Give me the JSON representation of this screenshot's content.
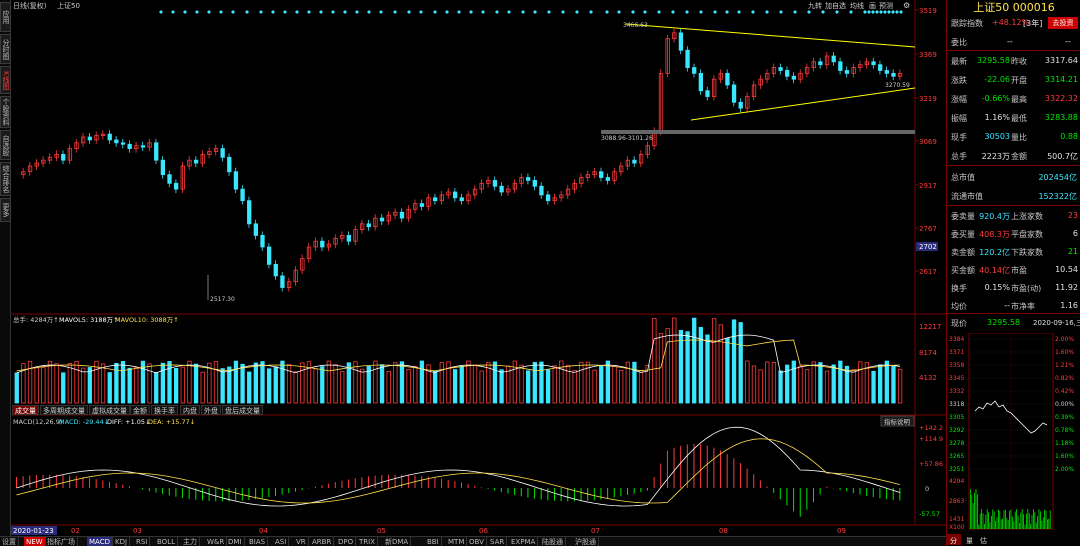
{
  "left_tabs": [
    "应用",
    "分时图",
    "K线图",
    "个股资料",
    "自选股",
    "综合排名",
    "更多"
  ],
  "kline_header": {
    "period": "日线(复权)",
    "name": "上证50"
  },
  "toolbar_top": [
    "九转",
    "加自选",
    "均线",
    "画",
    "预测"
  ],
  "price_axis": [
    "3519",
    "3369",
    "3219",
    "3069",
    "2917",
    "2767",
    "2702",
    "2617"
  ],
  "annotations": {
    "high": "3466.63",
    "low": "2517.30",
    "range": "3088.96-3101.26",
    "trend": "3270.59"
  },
  "volume_info": {
    "total": "总手: 4284万↑",
    "ma5": "MAVOL5: 3188万↑",
    "ma10": "MAVOL10: 3088万↑"
  },
  "volume_axis": [
    "12217",
    "8174",
    "4132"
  ],
  "volume_tabs": [
    "成交量",
    "多周期成交量",
    "虚拟成交量",
    "金额",
    "换手率",
    "内盘",
    "外盘",
    "盘后成交量"
  ],
  "macd_info": {
    "label": "MACD(12,26,9)",
    "macd": "MACD: -29.44↓",
    "diff": "DIFF: +1.05↓",
    "dea": "DEA: +15.77↓",
    "help": "指标说明"
  },
  "macd_axis": [
    "+142.2",
    "+114.9",
    "+57.86",
    "0",
    "-57.57"
  ],
  "x_axis": [
    "2020-01-23",
    "02",
    "03",
    "04",
    "05",
    "06",
    "07",
    "08",
    "09"
  ],
  "bottom_tabs": [
    "设置",
    "NEW",
    "指标广场",
    "MACD",
    "KDJ",
    "RSI",
    "BOLL",
    "主力",
    "W&R",
    "DMI",
    "BIAS",
    "ASI",
    "VR",
    "ARBR",
    "DPO",
    "TRIX",
    "新DMA",
    "BBI",
    "MTM",
    "OBV",
    "SAR",
    "EXPMA",
    "陆股通",
    "沪股通"
  ],
  "right_panel": {
    "title": "上证50  000016",
    "track": {
      "label": "跟踪指数",
      "value": "+48.12%",
      "period": "[3年]",
      "btn": "去投资"
    },
    "weibi": {
      "label": "委比",
      "v1": "--",
      "v2": "--"
    },
    "quote": [
      {
        "l1": "最新",
        "v1": "3295.58",
        "c1": "green",
        "l2": "昨收",
        "v2": "3317.64",
        "c2": "white"
      },
      {
        "l1": "涨跌",
        "v1": "-22.06",
        "c1": "green",
        "l2": "开盘",
        "v2": "3314.21",
        "c2": "green"
      },
      {
        "l1": "涨幅",
        "v1": "-0.66%",
        "c1": "green",
        "l2": "最高",
        "v2": "3322.32",
        "c2": "red"
      },
      {
        "l1": "振幅",
        "v1": "1.16%",
        "c1": "white",
        "l2": "最低",
        "v2": "3283.88",
        "c2": "green"
      },
      {
        "l1": "现手",
        "v1": "30503",
        "c1": "cyan",
        "l2": "量比",
        "v2": "0.88",
        "c2": "green"
      },
      {
        "l1": "总手",
        "v1": "2223万",
        "c1": "white",
        "l2": "金额",
        "v2": "500.7亿",
        "c2": "white"
      }
    ],
    "mktcap": {
      "l": "总市值",
      "v": "202454亿"
    },
    "float": {
      "l": "流通市值",
      "v": "152322亿"
    },
    "orders": [
      {
        "l1": "委卖量",
        "v1": "920.4万",
        "c1": "cyan",
        "l2": "上涨家数",
        "v2": "23",
        "c2": "red"
      },
      {
        "l1": "委买量",
        "v1": "408.3万",
        "c1": "red",
        "l2": "平盘家数",
        "v2": "6",
        "c2": "white"
      },
      {
        "l1": "卖金额",
        "v1": "120.2亿",
        "c1": "cyan",
        "l2": "下跌家数",
        "v2": "21",
        "c2": "green"
      },
      {
        "l1": "买金额",
        "v1": "40.14亿",
        "c1": "red",
        "l2": "市盈",
        "v2": "10.54",
        "c2": "white"
      },
      {
        "l1": "换手",
        "v1": "0.15%",
        "c1": "white",
        "l2": "市盈(动)",
        "v2": "11.92",
        "c2": "white"
      },
      {
        "l1": "均价",
        "v1": "--",
        "c1": "white",
        "l2": "市净率",
        "v2": "1.16",
        "c2": "white"
      }
    ],
    "mini": {
      "label": "现价",
      "price": "3295.58",
      "date": "2020-09-16,三",
      "left_axis": [
        "3384",
        "3371",
        "3358",
        "3345",
        "3332",
        "3318",
        "3305",
        "3292",
        "3278",
        "3265",
        "3251"
      ],
      "right_axis": [
        "2.00%",
        "1.60%",
        "1.21%",
        "0.82%",
        "0.42%",
        "0.00%",
        "0.39%",
        "0.78%",
        "1.18%",
        "1.60%",
        "2.00%"
      ],
      "vol_axis": [
        "4294",
        "2863",
        "1431",
        "X100"
      ],
      "tabs": [
        "分",
        "量",
        "估"
      ]
    }
  },
  "colors": {
    "up": "#ff3b3b",
    "down": "#3be6ff",
    "ma5": "#ffffff",
    "ma10": "#ffe14a",
    "trend": "#ffff00",
    "grid": "#7a0000"
  }
}
